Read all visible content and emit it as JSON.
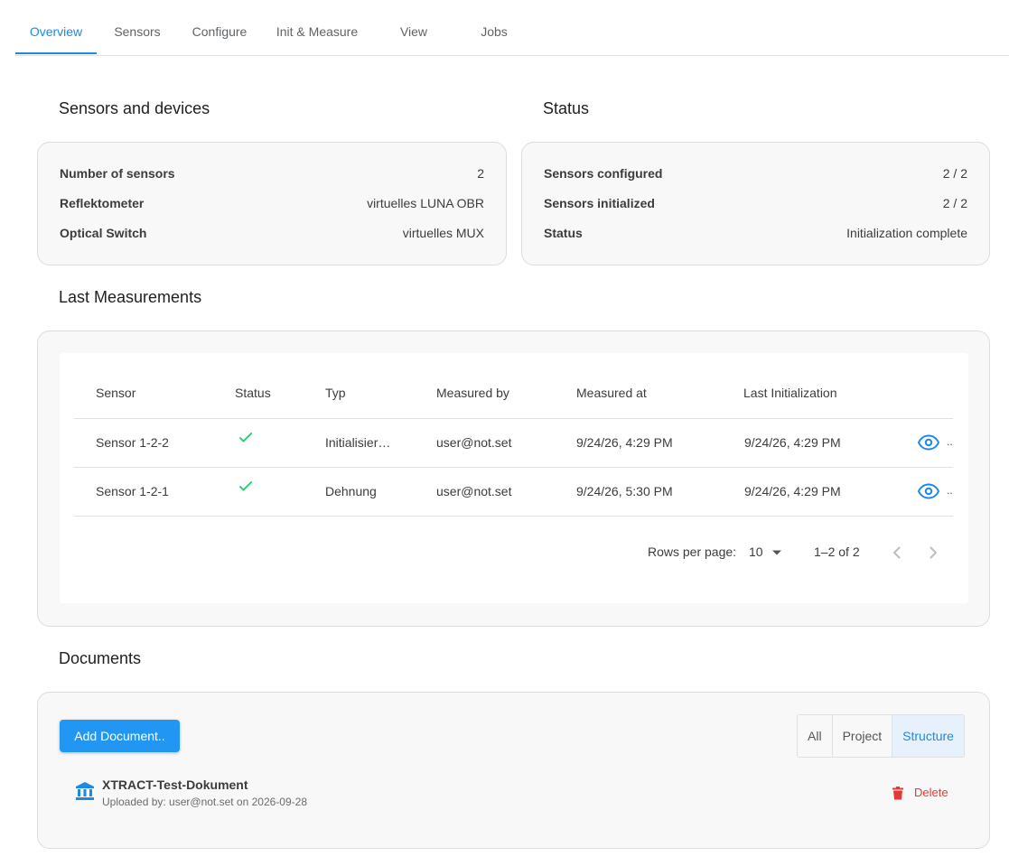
{
  "tabs": [
    {
      "label": "Overview",
      "active": true
    },
    {
      "label": "Sensors"
    },
    {
      "label": "Configure"
    },
    {
      "label": "Init & Measure"
    },
    {
      "label": "View"
    },
    {
      "label": "Jobs"
    }
  ],
  "sensors_section": {
    "title": "Sensors and devices",
    "rows": [
      {
        "key": "Number of sensors",
        "value": "2"
      },
      {
        "key": "Reflektometer",
        "value": "virtuelles LUNA OBR"
      },
      {
        "key": "Optical Switch",
        "value": "virtuelles MUX"
      }
    ]
  },
  "status_section": {
    "title": "Status",
    "rows": [
      {
        "key": "Sensors configured",
        "value": "2 / 2"
      },
      {
        "key": "Sensors initialized",
        "value": "2 / 2"
      },
      {
        "key": "Status",
        "value": "Initialization complete"
      }
    ]
  },
  "measurements": {
    "title": "Last Measurements",
    "columns": [
      "Sensor",
      "Status",
      "Typ",
      "Measured by",
      "Measured at",
      "Last Initialization"
    ],
    "rows": [
      {
        "sensor": "Sensor 1-2-2",
        "status": "ok",
        "typ": "Initialisier…",
        "measured_by": "user@not.set",
        "measured_at": "9/24/26, 4:29 PM",
        "last_init": "9/24/26, 4:29 PM",
        "overflow": ".."
      },
      {
        "sensor": "Sensor 1-2-1",
        "status": "ok",
        "typ": "Dehnung",
        "measured_by": "user@not.set",
        "measured_at": "9/24/26, 5:30 PM",
        "last_init": "9/24/26, 4:29 PM",
        "overflow": ".."
      }
    ],
    "footer": {
      "rows_per_page_label": "Rows per page:",
      "rows_per_page": "10",
      "range": "1–2 of 2"
    }
  },
  "documents": {
    "title": "Documents",
    "add_button": "Add Document..",
    "filters": [
      {
        "label": "All"
      },
      {
        "label": "Project"
      },
      {
        "label": "Structure",
        "active": true
      }
    ],
    "items": [
      {
        "name": "XTRACT-Test-Dokument",
        "meta": "Uploaded by: user@not.set on 2026-09-28",
        "delete_label": "Delete"
      }
    ]
  },
  "colors": {
    "accent": "#1e88e5",
    "success": "#2ecc71",
    "danger": "#e53935"
  }
}
